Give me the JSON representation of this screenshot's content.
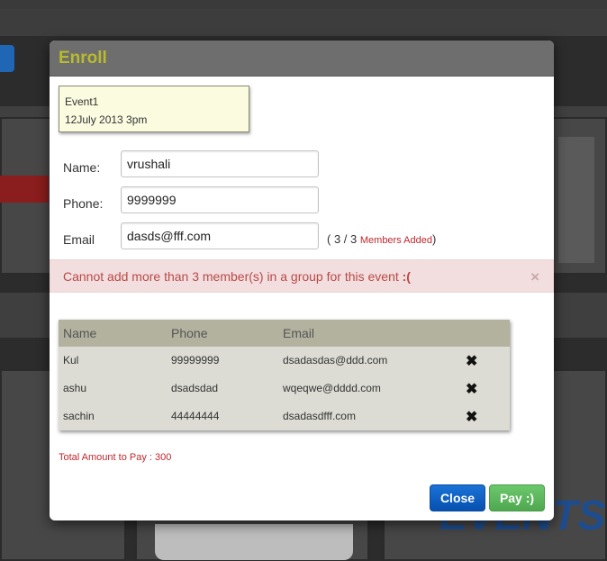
{
  "modal": {
    "title": "Enroll"
  },
  "event": {
    "name": "Event1",
    "datetime": "12July 2013 3pm"
  },
  "form": {
    "name_label": "Name:",
    "name_value": "vrushali",
    "phone_label": "Phone:",
    "phone_value": "9999999",
    "email_label": "Email",
    "email_value": "dasds@fff.com",
    "members_count_open": "( 3 / 3",
    "members_count_text": "Members Added",
    "members_count_close": ")"
  },
  "alert": {
    "message": "Cannot add more than 3 member(s) in a group for this event",
    "emoticon": ":(",
    "close_symbol": "×"
  },
  "members_table": {
    "headers": [
      "Name",
      "Phone",
      "Email"
    ],
    "rows": [
      {
        "name": "Kul",
        "phone": "99999999",
        "email": "dsadasdas@ddd.com"
      },
      {
        "name": "ashu",
        "phone": "dsadsdad",
        "email": "wqeqwe@dddd.com"
      },
      {
        "name": "sachin",
        "phone": "44444444",
        "email": "dsadasdfff.com"
      }
    ],
    "remove_symbol": "✖"
  },
  "total": {
    "text": "Total Amount to Pay : 300"
  },
  "buttons": {
    "close_label": "Close",
    "pay_label": "Pay :)"
  },
  "background": {
    "banner_text": "EVENTS"
  },
  "colors": {
    "title": "#b8bb2d",
    "alert_text": "#b94a48",
    "alert_bg": "#f2dede",
    "close_button": "#0a5fc4",
    "pay_button": "#5cb85c",
    "highlight_red": "#c0272d"
  }
}
